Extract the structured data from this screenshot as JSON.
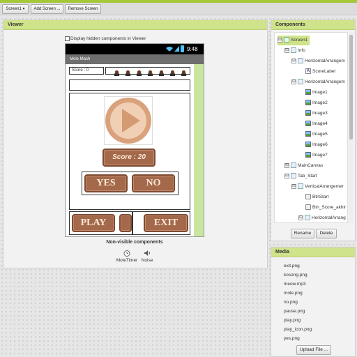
{
  "toolbar": {
    "screen_select": "Screen1 ▾",
    "add_screen": "Add Screen ...",
    "remove_screen": "Remove Screen"
  },
  "viewer": {
    "header": "Viewer",
    "hidden_checkbox_label": "Display hidden components in Viewer",
    "phone": {
      "time": "9:48",
      "app_title": "Mole Mash",
      "score_label": "Score : 0",
      "score_button": "Score : 20",
      "yes": "YES",
      "no": "NO",
      "play": "PLAY",
      "exit": "EXIT"
    },
    "nonvisible_title": "Non-visible components",
    "nonvisible": [
      {
        "label": "MoleTimer",
        "icon": "timer-icon"
      },
      {
        "label": "Noise",
        "icon": "sound-icon"
      }
    ]
  },
  "components": {
    "header": "Components",
    "items": [
      {
        "label": "Screen1",
        "toggle": "⊟",
        "icon": "screen"
      },
      {
        "label": "Info",
        "toggle": "⊟",
        "icon": "arr"
      },
      {
        "label": "HorizontalArrangem",
        "toggle": "⊟",
        "icon": "arr"
      },
      {
        "label": "ScoreLabel",
        "toggle": "",
        "icon": "label"
      },
      {
        "label": "HorizontalArrangem",
        "toggle": "⊟",
        "icon": "arr"
      },
      {
        "label": "Image1",
        "toggle": "",
        "icon": "img"
      },
      {
        "label": "Image2",
        "toggle": "",
        "icon": "img"
      },
      {
        "label": "Image3",
        "toggle": "",
        "icon": "img"
      },
      {
        "label": "Image4",
        "toggle": "",
        "icon": "img"
      },
      {
        "label": "Image5",
        "toggle": "",
        "icon": "img"
      },
      {
        "label": "Image6",
        "toggle": "",
        "icon": "img"
      },
      {
        "label": "Image7",
        "toggle": "",
        "icon": "img"
      },
      {
        "label": "MainCanvas",
        "toggle": "⊞",
        "icon": "arr"
      },
      {
        "label": "Tab_Start",
        "toggle": "⊟",
        "icon": "arr"
      },
      {
        "label": "VerticalArrangemer",
        "toggle": "⊟",
        "icon": "arr"
      },
      {
        "label": "BtnStart",
        "toggle": "",
        "icon": "btn"
      },
      {
        "label": "Btn_Score_akhir",
        "toggle": "",
        "icon": "btn"
      },
      {
        "label": "HorizontalArrang",
        "toggle": "⊟",
        "icon": "arr"
      }
    ],
    "rename": "Rename",
    "delete": "Delete"
  },
  "media": {
    "header": "Media",
    "files": [
      "exit.png",
      "kosong.png",
      "meow.mp3",
      "mole.png",
      "no.png",
      "pause.png",
      "play.png",
      "play_icon.png",
      "yes.png"
    ],
    "upload": "Upload File ..."
  }
}
